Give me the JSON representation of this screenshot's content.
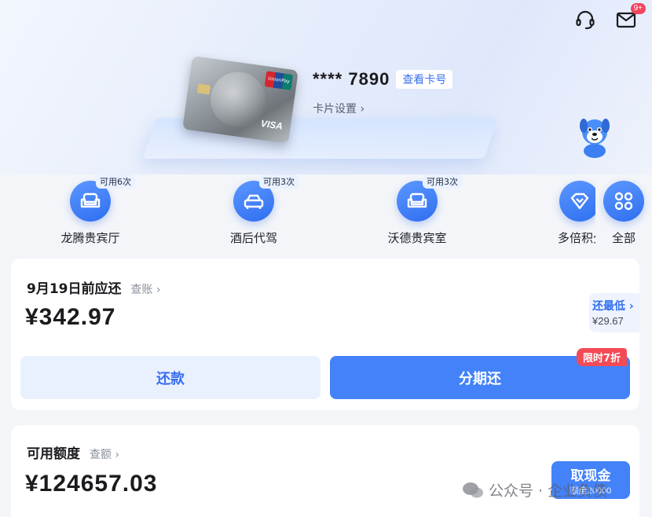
{
  "header": {
    "badge": "9+"
  },
  "card": {
    "masked_number": "**** 7890",
    "view_number_label": "查看卡号",
    "settings_label": "卡片设置",
    "brand_visa": "VISA"
  },
  "quick_actions": [
    {
      "label": "龙腾贵宾厅",
      "tag": "可用6次",
      "icon": "sofa-icon"
    },
    {
      "label": "酒后代驾",
      "tag": "可用3次",
      "icon": "car-icon"
    },
    {
      "label": "沃德贵宾室",
      "tag": "可用3次",
      "icon": "sofa-icon"
    },
    {
      "label": "多倍积分",
      "tag": "",
      "icon": "diamond-icon"
    },
    {
      "label": "全部",
      "tag": "",
      "icon": "grid-icon"
    }
  ],
  "bill": {
    "due_title": "9月19日前应还",
    "check_label": "查账",
    "amount": "¥342.97",
    "min_label": "还最低",
    "min_amount": "¥29.67",
    "repay_label": "还款",
    "installment_label": "分期还",
    "promo_label": "限时7折"
  },
  "credit": {
    "title": "可用额度",
    "check_label": "查额",
    "amount": "¥124657.03",
    "cash_label": "取现金",
    "cash_sub": "额度20000"
  },
  "watermark": {
    "text": "公众号 · 企业负债"
  },
  "colors": {
    "accent": "#4382f8",
    "promo": "#f34a56",
    "badge": "#f2445b"
  }
}
